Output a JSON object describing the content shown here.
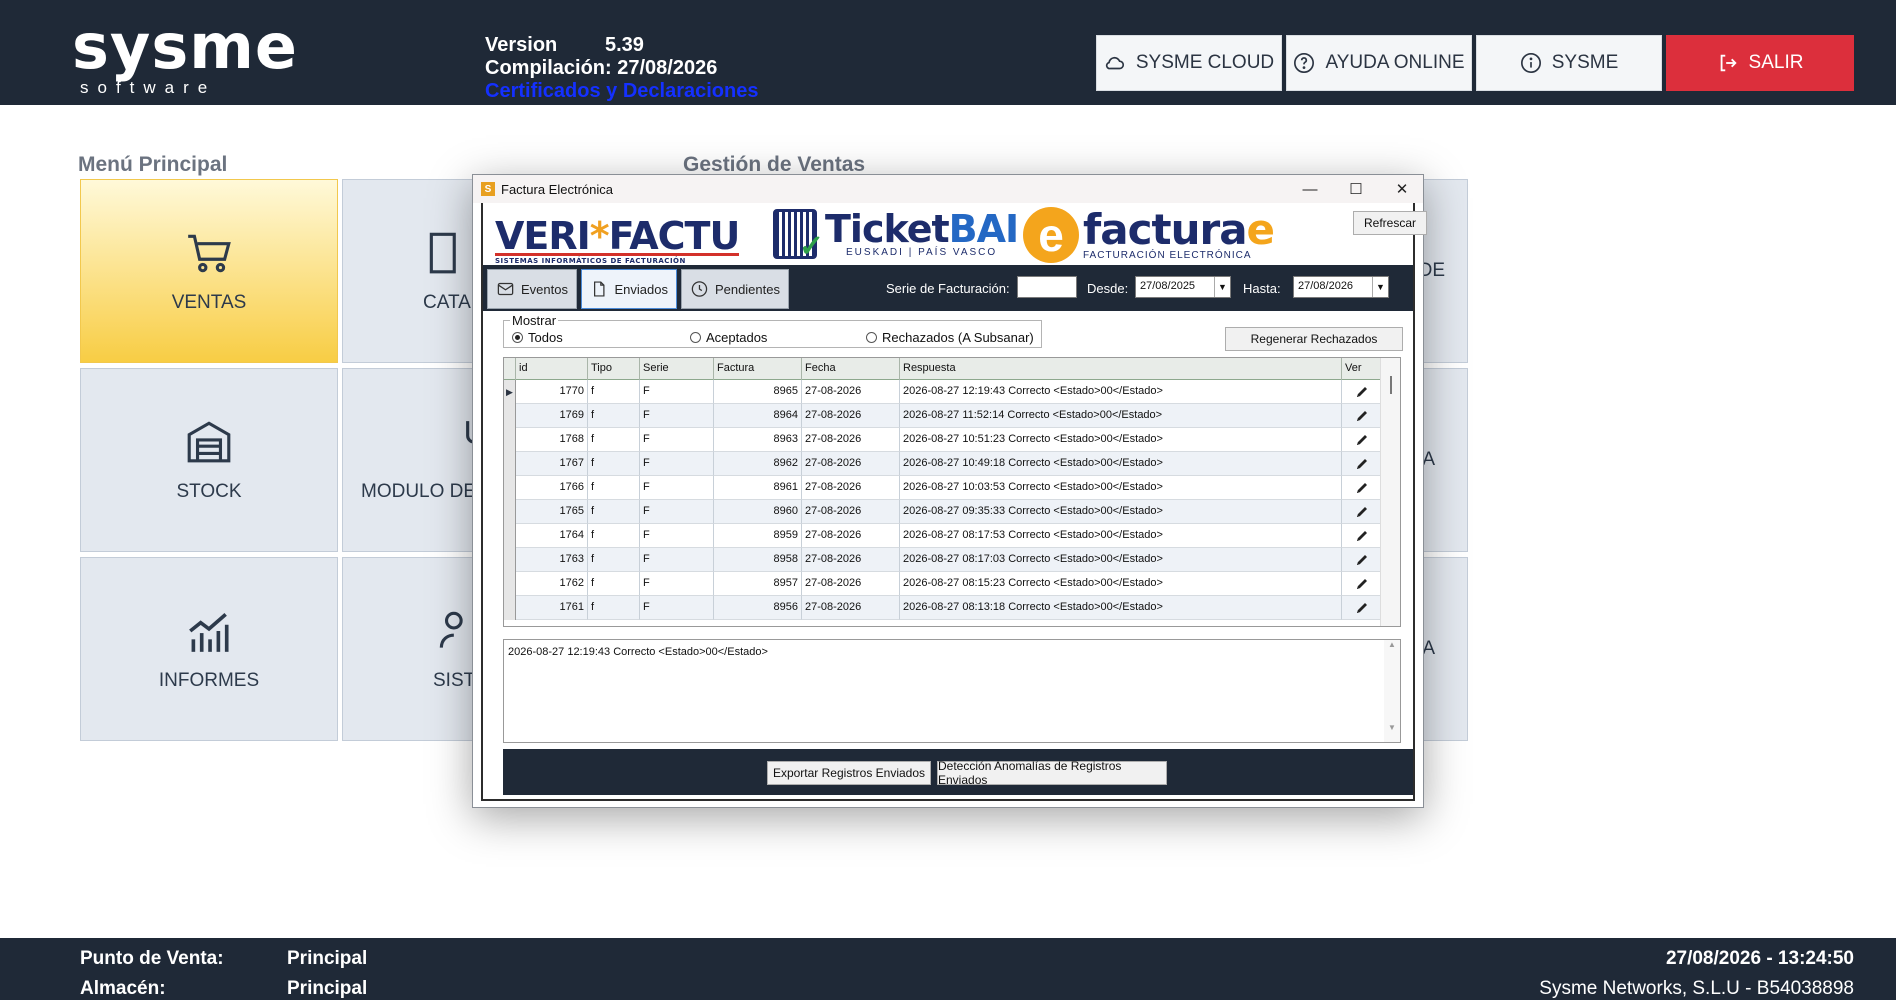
{
  "header": {
    "logo_main": "sysme",
    "logo_sub": "software",
    "version_label": "Version",
    "version_value": "5.39",
    "compilation_label": "Compilación:",
    "compilation_value": "27/08/2026",
    "certificates_link": "Certificados y Declaraciones",
    "buttons": [
      {
        "label": "SYSME CLOUD",
        "icon": "cloud-icon"
      },
      {
        "label": "AYUDA ONLINE",
        "icon": "help-circle-icon"
      },
      {
        "label": "SYSME",
        "icon": "info-circle-icon"
      },
      {
        "label": "SALIR",
        "icon": "logout-icon"
      }
    ]
  },
  "main_menu": {
    "title": "Menú Principal",
    "tiles": [
      {
        "label": "VENTAS",
        "icon": "cart-icon",
        "active": true
      },
      {
        "label": "CATAL",
        "icon": "book-icon"
      },
      {
        "label": "STOCK",
        "icon": "warehouse-icon"
      },
      {
        "label": "MODULO DE",
        "icon": "fork-icon"
      },
      {
        "label": "INFORMES",
        "icon": "chart-icon"
      },
      {
        "label": "SISTE",
        "icon": "user-settings-icon"
      }
    ]
  },
  "sales_section": {
    "title": "Gestión de Ventas",
    "tiles_partial": [
      "DE",
      "A",
      "A"
    ]
  },
  "dialog": {
    "title": "Factura Electrónica",
    "logos": {
      "verifactu_left": "VERI",
      "verifactu_star": "*",
      "verifactu_right": "FACTU",
      "verifactu_sub": "SISTEMAS INFORMÁTICOS DE FACTURACIÓN",
      "ticketbai_a": "Ticket",
      "ticketbai_b": "BAI",
      "ticketbai_sub": "EUSKADI | PAÍS VASCO",
      "facturae_e": "e",
      "facturae_a": "factura",
      "facturae_b": "e",
      "facturae_sub": "FACTURACIÓN ELECTRÓNICA"
    },
    "refresh_button": "Refrescar",
    "tabs": [
      {
        "label": "Eventos",
        "icon": "envelope-icon"
      },
      {
        "label": "Enviados",
        "icon": "document-icon",
        "selected": true
      },
      {
        "label": "Pendientes",
        "icon": "clock-icon"
      }
    ],
    "serie_label": "Serie de Facturación:",
    "serie_value": "",
    "desde_label": "Desde:",
    "desde_value": "27/08/2025",
    "hasta_label": "Hasta:",
    "hasta_value": "27/08/2026",
    "mostrar_label": "Mostrar",
    "radios": [
      {
        "label": "Todos",
        "checked": true
      },
      {
        "label": "Aceptados",
        "checked": false
      },
      {
        "label": "Rechazados (A Subsanar)",
        "checked": false
      }
    ],
    "regenerate_button": "Regenerar Rechazados",
    "columns": [
      "id",
      "Tipo",
      "Serie",
      "Factura",
      "Fecha",
      "Respuesta",
      "Ver"
    ],
    "rows": [
      {
        "id": "1770",
        "tipo": "f",
        "serie": "F",
        "factura": "8965",
        "fecha": "27-08-2026",
        "respuesta": "2026-08-27 12:19:43 Correcto <Estado>00</Estado>"
      },
      {
        "id": "1769",
        "tipo": "f",
        "serie": "F",
        "factura": "8964",
        "fecha": "27-08-2026",
        "respuesta": "2026-08-27 11:52:14 Correcto <Estado>00</Estado>"
      },
      {
        "id": "1768",
        "tipo": "f",
        "serie": "F",
        "factura": "8963",
        "fecha": "27-08-2026",
        "respuesta": "2026-08-27 10:51:23 Correcto <Estado>00</Estado>"
      },
      {
        "id": "1767",
        "tipo": "f",
        "serie": "F",
        "factura": "8962",
        "fecha": "27-08-2026",
        "respuesta": "2026-08-27 10:49:18 Correcto <Estado>00</Estado>"
      },
      {
        "id": "1766",
        "tipo": "f",
        "serie": "F",
        "factura": "8961",
        "fecha": "27-08-2026",
        "respuesta": "2026-08-27 10:03:53 Correcto <Estado>00</Estado>"
      },
      {
        "id": "1765",
        "tipo": "f",
        "serie": "F",
        "factura": "8960",
        "fecha": "27-08-2026",
        "respuesta": "2026-08-27 09:35:33 Correcto <Estado>00</Estado>"
      },
      {
        "id": "1764",
        "tipo": "f",
        "serie": "F",
        "factura": "8959",
        "fecha": "27-08-2026",
        "respuesta": "2026-08-27 08:17:53 Correcto <Estado>00</Estado>"
      },
      {
        "id": "1763",
        "tipo": "f",
        "serie": "F",
        "factura": "8958",
        "fecha": "27-08-2026",
        "respuesta": "2026-08-27 08:17:03 Correcto <Estado>00</Estado>"
      },
      {
        "id": "1762",
        "tipo": "f",
        "serie": "F",
        "factura": "8957",
        "fecha": "27-08-2026",
        "respuesta": "2026-08-27 08:15:23 Correcto <Estado>00</Estado>"
      },
      {
        "id": "1761",
        "tipo": "f",
        "serie": "F",
        "factura": "8956",
        "fecha": "27-08-2026",
        "respuesta": "2026-08-27 08:13:18 Correcto <Estado>00</Estado>"
      }
    ],
    "detail_text": "2026-08-27 12:19:43 Correcto <Estado>00</Estado>",
    "export_button": "Exportar Registros Enviados",
    "anomaly_button": "Detección Anomalías de Registros Enviados"
  },
  "footer": {
    "pos_label": "Punto de Venta:",
    "pos_value": "Principal",
    "warehouse_label": "Almacén:",
    "warehouse_value": "Principal",
    "datetime": "27/08/2026 - 13:24:50",
    "company": "Sysme Networks, S.L.U - B54038898"
  },
  "colors": {
    "header_bg": "#1f2937",
    "exit_red": "#dc2f3c",
    "active_tile": "#f8cd44",
    "tile_bg": "#e3e8ef"
  }
}
